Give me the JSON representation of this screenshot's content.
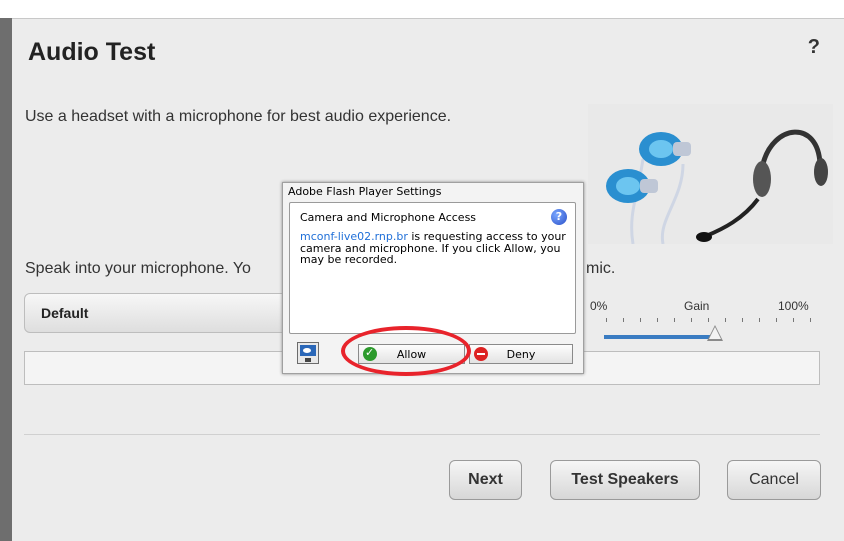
{
  "dialog": {
    "title": "Audio Test",
    "help_label": "?",
    "subtitle": "Use a headset with a microphone for best audio experience.",
    "speak_instruction": "Speak into your microphone. Yo",
    "speak_instruction_tail": "se another mic.",
    "mic_select": {
      "selected": "Default"
    },
    "gain": {
      "min_label": "0%",
      "label": "Gain",
      "max_label": "100%",
      "level_percent": 55
    },
    "buttons": {
      "next": "Next",
      "test_speakers": "Test Speakers",
      "cancel": "Cancel"
    }
  },
  "flash_dialog": {
    "title": "Adobe Flash Player Settings",
    "heading": "Camera and Microphone Access",
    "help_label": "?",
    "link_text": "mconf-live02.rnp.br",
    "body_text": " is requesting access to your camera and microphone. If you click Allow, you may be recorded.",
    "allow_label": "Allow",
    "deny_label": "Deny"
  },
  "colors": {
    "annotation_circle": "#e8232b",
    "slider_fill": "#3a7cc2",
    "link": "#1f6fd8"
  }
}
